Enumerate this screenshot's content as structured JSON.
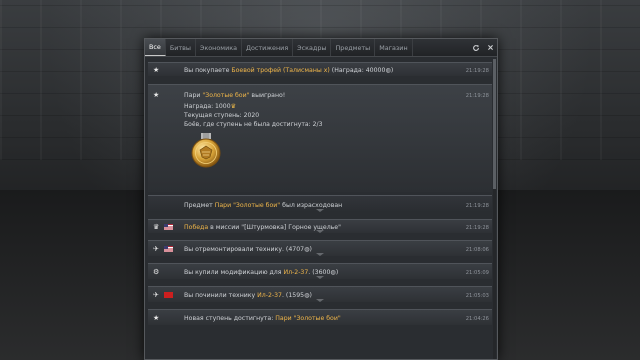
{
  "tabs": [
    "Все",
    "Битвы",
    "Экономика",
    "Достижения",
    "Эскадры",
    "Предметы",
    "Магазин"
  ],
  "icons": {
    "refresh": "refresh-icon",
    "close": "close-icon"
  },
  "rows": {
    "r1": {
      "text_a": "Вы покупаете ",
      "highlight": "Боевой трофей (Талисманы x)",
      "text_b": " (Награда: 40000",
      "currency": "Серебряные львы",
      "text_c": ")",
      "time": "21:19:28",
      "icon": "star-icon"
    },
    "r2": {
      "title_a": "Пари ",
      "title_hl": "\"Золотые бои\"",
      "title_b": " выиграно!",
      "line1_label": "Награда: 1000",
      "line1_currency": "Золотые орлы",
      "line2": "Текущая ступень: 2020",
      "line3": "Боёв, где ступень не была достигнута: 2/3",
      "time": "21:19:28",
      "icon": "star-icon",
      "medal": "gold-medal-icon"
    },
    "r3": {
      "text_a": "Предмет ",
      "highlight": "Пари \"Золотые бои\"",
      "text_b": " был израсходован",
      "time": "21:19:28"
    },
    "r4": {
      "highlight": "Победа",
      "text_a": " в миссии \"[Штурмовка] Горное ущелье\"",
      "text_b": "",
      "time": "21:19:28",
      "icon": "trophy-icon",
      "flag": "usa"
    },
    "r5": {
      "text_a": "Вы отремонтировали технику. (4707",
      "currency": "Серебряные львы",
      "text_b": ")",
      "time": "21:08:06",
      "icon": "wrench-icon",
      "flag": "usa"
    },
    "r6": {
      "text_a": "Вы купили модификацию для ",
      "highlight": "Ил-2-37",
      "text_b": ". (3600",
      "currency": "Серебряные львы",
      "text_c": ")",
      "time": "21:05:09",
      "icon": "modification-icon"
    },
    "r7": {
      "text_a": "Вы починили технику ",
      "highlight": "Ил-2-37",
      "text_b": ". (1595",
      "currency": "Серебряные львы",
      "text_c": ")",
      "time": "21:05:03",
      "icon": "wrench-icon",
      "flag": "ussr"
    },
    "r8": {
      "text_a": "Новая ступень достигнута: ",
      "highlight": "Пари \"Золотые бои\"",
      "time": "21:04:26",
      "icon": "star-icon"
    }
  }
}
